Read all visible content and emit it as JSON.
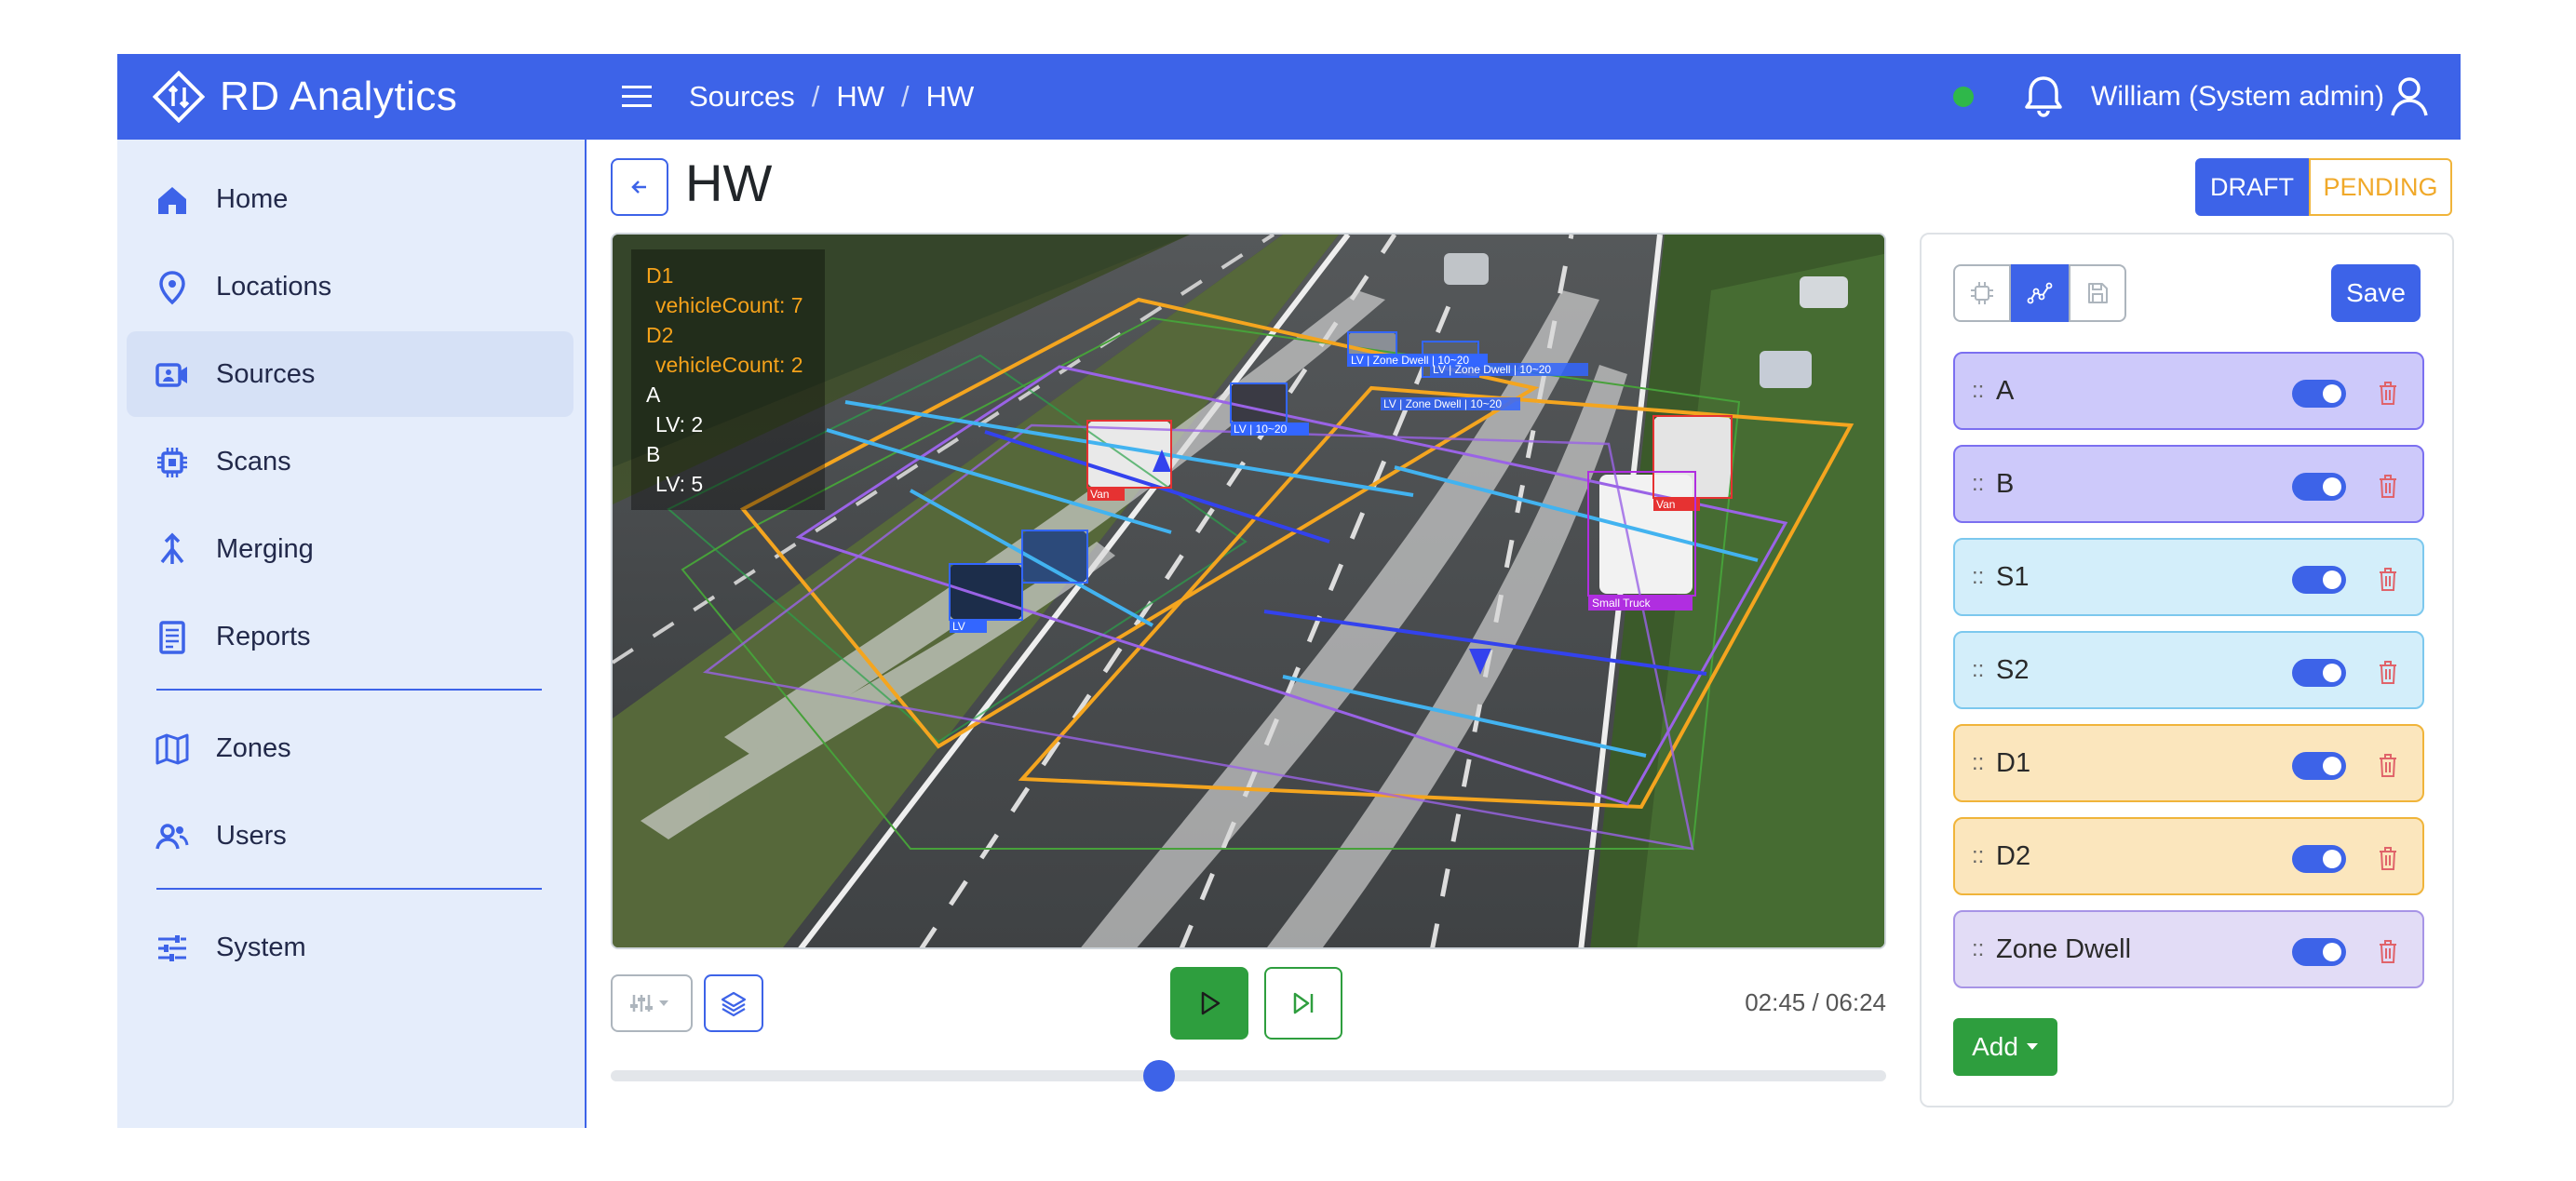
{
  "app": {
    "brand": "RD Analytics"
  },
  "header": {
    "breadcrumb": [
      "Sources",
      "HW",
      "HW"
    ],
    "user": "William (System admin)",
    "status_color": "#2fb84a"
  },
  "sidebar": {
    "items": [
      {
        "label": "Home",
        "icon": "home-icon"
      },
      {
        "label": "Locations",
        "icon": "map-pin-icon"
      },
      {
        "label": "Sources",
        "icon": "video-camera-icon",
        "active": true
      },
      {
        "label": "Scans",
        "icon": "chip-icon"
      },
      {
        "label": "Merging",
        "icon": "merge-icon"
      },
      {
        "label": "Reports",
        "icon": "report-icon"
      },
      {
        "label": "Zones",
        "icon": "map-icon"
      },
      {
        "label": "Users",
        "icon": "users-icon"
      },
      {
        "label": "System",
        "icon": "sliders-icon"
      }
    ]
  },
  "page": {
    "title": "HW",
    "status_draft": "DRAFT",
    "status_pending": "PENDING"
  },
  "video": {
    "overlay": {
      "d1": "D1",
      "d1_metric": "vehicleCount: 7",
      "d2": "D2",
      "d2_metric": "vehicleCount: 2",
      "a": "A",
      "a_metric": "LV: 2",
      "b": "B",
      "b_metric": "LV: 5"
    },
    "detections": {
      "van1": "Van",
      "van2": "Van",
      "truck": "Small Truck",
      "lv1": "LV | 10~20",
      "lv2": "LV | Zone Dwell | 10~20",
      "lv3": "LV | Zone Dwell | 10~20",
      "lv4": "LV | Zone Dwell | 10~20",
      "lv5": "LV"
    },
    "time": "02:45 / 06:24",
    "progress": 0.43
  },
  "panel": {
    "save_label": "Save",
    "add_label": "Add",
    "zones": [
      {
        "name": "A",
        "bg": "#cdc9fa",
        "border": "#7b6ff0",
        "enabled": true
      },
      {
        "name": "B",
        "bg": "#cdc9fa",
        "border": "#7b6ff0",
        "enabled": true
      },
      {
        "name": "S1",
        "bg": "#d3eefa",
        "border": "#7cc8ee",
        "enabled": true
      },
      {
        "name": "S2",
        "bg": "#d3eefa",
        "border": "#7cc8ee",
        "enabled": true
      },
      {
        "name": "D1",
        "bg": "#fbe6bd",
        "border": "#f0b43a",
        "enabled": true
      },
      {
        "name": "D2",
        "bg": "#fbe6bd",
        "border": "#f0b43a",
        "enabled": true
      },
      {
        "name": "Zone Dwell",
        "bg": "#e2dcf6",
        "border": "#a794e6",
        "enabled": true
      }
    ]
  },
  "colors": {
    "primary": "#3d63e8",
    "success": "#2e9e3e",
    "pending": "#f0a92a",
    "danger": "#e0636a"
  }
}
